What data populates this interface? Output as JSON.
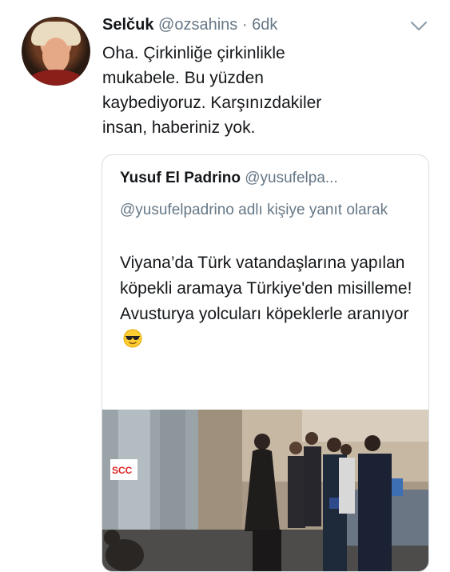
{
  "tweet": {
    "author_name": "Selčuk",
    "author_handle": "@ozsahins",
    "separator": " · ",
    "time": "6dk",
    "text": "Oha. Çirkinliğe çirkinlikle mukabele. Bu yüzden kaybediyoruz. Karşınızdakiler insan, haberiniz yok."
  },
  "quoted_tweet": {
    "author_name": "Yusuf El Padrino",
    "author_handle": "@yusufelpa...",
    "reply_line": "@yusufelpadrino adlı kişiye yanıt olarak",
    "text": "Viyana’da Türk vatandaşlarına yapılan köpekli aramaya Türkiye'den misilleme! Avusturya yolcuları köpeklerle aranıyor",
    "emoji": "smiling-face-with-sunglasses"
  },
  "media": {
    "sign_text": "SCC"
  },
  "icons": {
    "menu": "chevron-down-icon"
  },
  "colors": {
    "text": "#14171a",
    "secondary": "#657786",
    "border": "#d6dde3"
  }
}
